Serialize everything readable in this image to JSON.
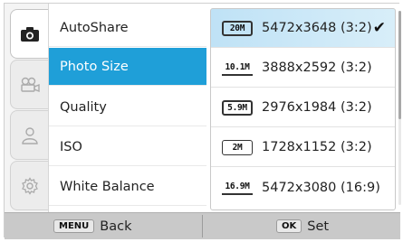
{
  "menu": {
    "items": [
      {
        "label": "AutoShare",
        "selected": false
      },
      {
        "label": "Photo Size",
        "selected": true
      },
      {
        "label": "Quality",
        "selected": false
      },
      {
        "label": "ISO",
        "selected": false
      },
      {
        "label": "White Balance",
        "selected": false
      }
    ]
  },
  "tabs": [
    {
      "icon": "camera-icon",
      "active": true
    },
    {
      "icon": "video-camera-icon",
      "active": false
    },
    {
      "icon": "person-icon",
      "active": false
    },
    {
      "icon": "gear-icon",
      "active": false
    }
  ],
  "submenu": {
    "options": [
      {
        "badge": "20M",
        "label": "5472x3648 (3:2)",
        "selected": true
      },
      {
        "badge": "10.1M",
        "label": "3888x2592 (3:2)",
        "selected": false
      },
      {
        "badge": "5.9M",
        "label": "2976x1984 (3:2)",
        "selected": false
      },
      {
        "badge": "2M",
        "label": "1728x1152 (3:2)",
        "selected": false
      },
      {
        "badge": "16.9M",
        "label": "5472x3080 (16:9)",
        "selected": false
      }
    ],
    "check_glyph": "✔"
  },
  "bottom_bar": {
    "back_key": "MENU",
    "back_label": "Back",
    "set_key": "OK",
    "set_label": "Set"
  },
  "colors": {
    "selection_blue": "#1f9fd8",
    "submenu_selection": "#cbe8f8"
  }
}
